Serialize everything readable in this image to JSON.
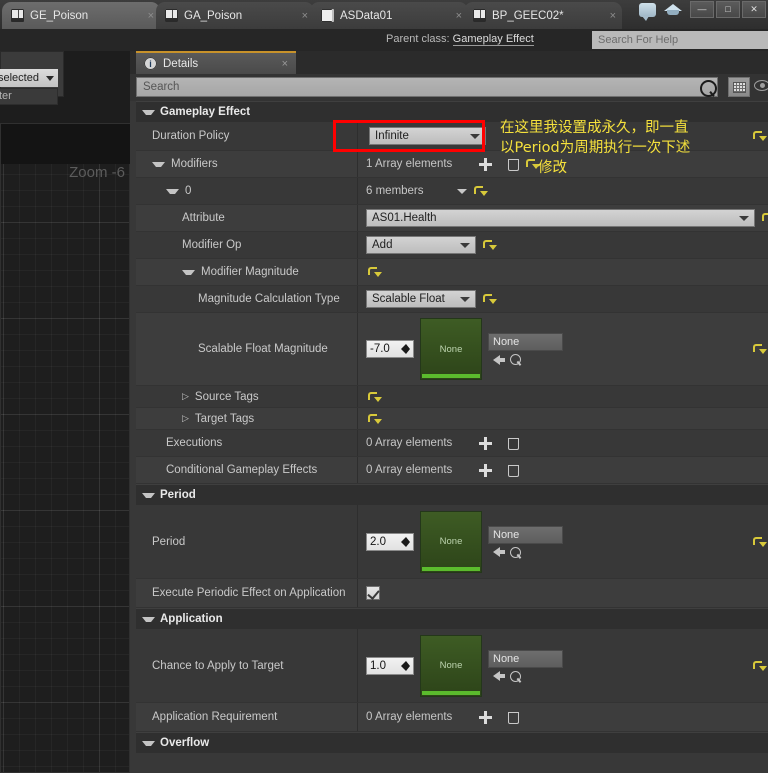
{
  "window": {
    "tabs": [
      {
        "label": "GE_Poison",
        "icon": "book-icon",
        "active": true,
        "closable": true
      },
      {
        "label": "GA_Poison",
        "icon": "book-icon",
        "active": false,
        "closable": true
      },
      {
        "label": "ASData01",
        "icon": "document-icon",
        "active": false,
        "closable": true
      },
      {
        "label": "BP_GEEC02*",
        "icon": "book-icon",
        "active": false,
        "closable": true
      }
    ],
    "close_glyph": "×",
    "toolbar_icons": [
      "comment-bubble-icon",
      "blueprint-cap-icon"
    ],
    "window_buttons": [
      {
        "name": "minimize-button",
        "glyph": "—"
      },
      {
        "name": "maximize-button",
        "glyph": "□"
      },
      {
        "name": "close-button",
        "glyph": "✕"
      }
    ]
  },
  "subbar": {
    "parent_class_label": "Parent class:",
    "parent_class_value": "Gameplay Effect",
    "help_search_placeholder": "Search For Help"
  },
  "graph": {
    "zoom_label": "Zoom -6",
    "selector_value": "selected",
    "filter_placeholder": "ter"
  },
  "details": {
    "tab_label": "Details",
    "tab_icon": "info-icon",
    "search_placeholder": "Search",
    "search_icon": "search-icon",
    "grid_button_icon": "grid-icon",
    "eye_button_icon": "eye-icon"
  },
  "sections": [
    {
      "name": "Gameplay Effect",
      "expanded": true,
      "rows": [
        {
          "label": "Duration Policy",
          "indent": 1,
          "type": "combo",
          "value": "Infinite",
          "reset": true,
          "highlight": true
        },
        {
          "label": "Modifiers",
          "indent": 1,
          "type": "array",
          "value": "1 Array elements",
          "expander": "open",
          "add": true,
          "delete": true,
          "reset": true
        },
        {
          "label": "0",
          "indent": 2,
          "type": "members",
          "value": "6 members",
          "expander": "open",
          "reset": true
        },
        {
          "label": "Attribute",
          "indent": 3,
          "type": "wide-combo",
          "value": "AS01.Health",
          "reset": true
        },
        {
          "label": "Modifier Op",
          "indent": 3,
          "type": "combo",
          "value": "Add",
          "reset": true
        },
        {
          "label": "Modifier Magnitude",
          "indent": 3,
          "type": "reset-only",
          "expander": "open",
          "reset": true
        },
        {
          "label": "Magnitude Calculation Type",
          "indent": 4,
          "type": "combo",
          "value": "Scalable Float",
          "reset": true
        },
        {
          "label": "Scalable Float Magnitude",
          "indent": 4,
          "type": "scalable-float",
          "value": "-7.0",
          "thumb_label": "None",
          "asset_value": "None",
          "reset": true
        },
        {
          "label": "Source Tags",
          "indent": 3,
          "type": "reset-only",
          "expander": "closed",
          "reset": true
        },
        {
          "label": "Target Tags",
          "indent": 3,
          "type": "reset-only",
          "expander": "closed",
          "reset": true
        },
        {
          "label": "Executions",
          "indent": 2,
          "type": "array",
          "value": "0 Array elements",
          "add": true,
          "delete": true
        },
        {
          "label": "Conditional Gameplay Effects",
          "indent": 2,
          "type": "array",
          "value": "0 Array elements",
          "add": true,
          "delete": true
        }
      ]
    },
    {
      "name": "Period",
      "expanded": true,
      "rows": [
        {
          "label": "Period",
          "indent": 1,
          "type": "scalable-float",
          "value": "2.0",
          "thumb_label": "None",
          "asset_value": "None",
          "reset": true
        },
        {
          "label": "Execute Periodic Effect on Application",
          "indent": 1,
          "type": "checkbox",
          "checked": true
        }
      ]
    },
    {
      "name": "Application",
      "expanded": true,
      "rows": [
        {
          "label": "Chance to Apply to Target",
          "indent": 1,
          "type": "scalable-float",
          "value": "1.0",
          "thumb_label": "None",
          "asset_value": "None",
          "reset": true
        },
        {
          "label": "Application Requirement",
          "indent": 1,
          "type": "array",
          "value": "0 Array elements",
          "add": true,
          "delete": true
        }
      ]
    },
    {
      "name": "Overflow",
      "expanded": true,
      "rows": []
    }
  ],
  "annotation": {
    "color": "#f5e13c",
    "highlight_color": "#ff0000",
    "line1": "在这里我设置成永久，即一直",
    "line2": "以Period为周期执行一次下述",
    "line3": "修改"
  }
}
